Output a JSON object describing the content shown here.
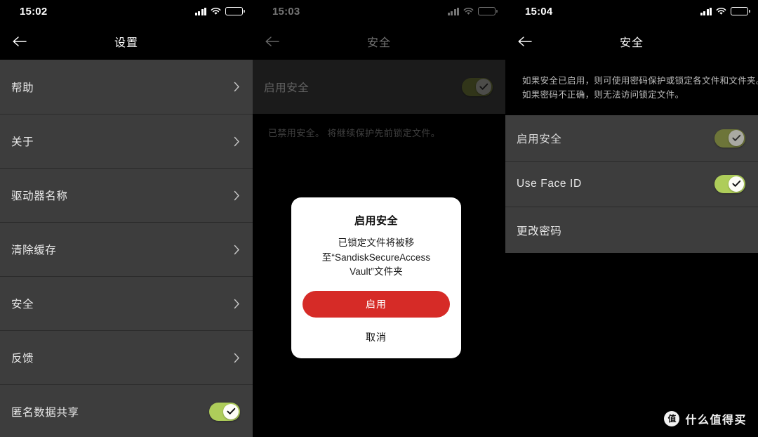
{
  "colors": {
    "toggle_on": "#aecd5a",
    "toggle_on_dimmed": "#6d7539",
    "row_bg": "#3d3d3d",
    "page_bg": "#000000",
    "confirm_red": "#d62b27"
  },
  "panels": [
    {
      "id": "settings",
      "status": {
        "clock": "15:02",
        "signal": "signal-bars-icon",
        "wifi": "wifi-icon",
        "battery": "battery-icon"
      },
      "nav": {
        "title": "设置",
        "back": "back-arrow-icon"
      },
      "rows": [
        {
          "label": "帮助",
          "accessory": "chevron"
        },
        {
          "label": "关于",
          "accessory": "chevron"
        },
        {
          "label": "驱动器名称",
          "accessory": "chevron"
        },
        {
          "label": "清除缓存",
          "accessory": "chevron"
        },
        {
          "label": "安全",
          "accessory": "chevron"
        },
        {
          "label": "反馈",
          "accessory": "chevron"
        },
        {
          "label": "匿名数据共享",
          "accessory": "toggle",
          "toggle_on": true,
          "dimmed": false
        }
      ]
    },
    {
      "id": "security-confirm",
      "status": {
        "clock": "15:03",
        "signal": "signal-bars-icon",
        "wifi": "wifi-icon",
        "battery": "battery-icon"
      },
      "nav": {
        "title": "安全",
        "back": "back-arrow-icon"
      },
      "rows": [
        {
          "label": "启用安全",
          "accessory": "toggle",
          "toggle_on": true,
          "dimmed": true
        }
      ],
      "hint": "已禁用安全。 将继续保护先前锁定文件。",
      "modal": {
        "title": "启用安全",
        "body": "已锁定文件将被移至“SandiskSecureAccess Vault”文件夹",
        "confirm_label": "启用",
        "cancel_label": "取消"
      }
    },
    {
      "id": "security-enabled",
      "status": {
        "clock": "15:04",
        "signal": "signal-bars-icon",
        "wifi": "wifi-icon",
        "battery": "battery-icon"
      },
      "nav": {
        "title": "安全",
        "back": "back-arrow-icon"
      },
      "description": [
        "如果安全已启用，则可使用密码保护或锁定各文件和文件夹。",
        "如果密码不正确，则无法访问锁定文件。"
      ],
      "rows": [
        {
          "label": "启用安全",
          "accessory": "toggle",
          "toggle_on": true,
          "dimmed": true
        },
        {
          "label": "Use Face ID",
          "accessory": "toggle",
          "toggle_on": true,
          "dimmed": false
        },
        {
          "label": "更改密码",
          "accessory": "none"
        }
      ]
    }
  ],
  "watermark": {
    "logo_char": "值",
    "text": "什么值得买"
  }
}
